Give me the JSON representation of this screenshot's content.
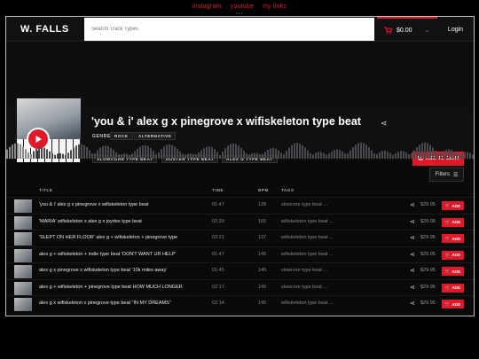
{
  "top_links": [
    "instagram",
    "youtube",
    "my links"
  ],
  "header": {
    "logo": "W. FALLS",
    "search_placeholder": "Search Track Types",
    "cart_total": "$0.00",
    "login_label": "Login"
  },
  "featured": {
    "title": "'you & i' alex g x pinegrove x wifiskeleton type beat",
    "genre_label": "GENRE",
    "genres": [
      "ROCK",
      "ALTERNATIVE"
    ],
    "tags": [
      "SLOWCORE TYPE BEAT",
      "DUSTER TYPE BEAT",
      "ALEX G TYPE BEAT"
    ],
    "buy_label": "ADD TO CART"
  },
  "filters_label": "Filters",
  "table": {
    "headers": {
      "title": "TITLE",
      "time": "TIME",
      "bpm": "BPM",
      "tags": "TAGS"
    },
    "add_label": "ADD",
    "rows": [
      {
        "title": "'you & i' alex g x pinegrove x wifiskeleton type beat",
        "time": "01:47",
        "bpm": "128",
        "tags": "slowcore type beat ...",
        "price": "$29.95"
      },
      {
        "title": "'MARIA' wifiskeleton x alex g x joydes type beat",
        "time": "02:29",
        "bpm": "165",
        "tags": "wifiskeleton type beat ...",
        "price": "$29.95"
      },
      {
        "title": "'SLEPT ON HER FLOOR' alex g + wifiskeleton + pinegrove type",
        "time": "03:21",
        "bpm": "137",
        "tags": "wifiskeleton type beat ...",
        "price": "$29.95"
      },
      {
        "title": "alex g + wifiskeleton + indie type beat 'DON'T WANT UR HELP'",
        "time": "01:47",
        "bpm": "145",
        "tags": "wifiskeleton type beat ...",
        "price": "$29.95"
      },
      {
        "title": "alex g x pinegrove x wifiskeleton type beat '10k miles away'",
        "time": "01:45",
        "bpm": "145",
        "tags": "slowcore type beat ...",
        "price": "$29.95"
      },
      {
        "title": "alex g + wifiskeleton + pinegrove type beat HOW MUCH LONGER",
        "time": "02:17",
        "bpm": "145",
        "tags": "slowcore type beat ...",
        "price": "$29.95"
      },
      {
        "title": "alex g x wifiskeleton x pinegrove type beat \"IN MY DREAMS\"",
        "time": "02:14",
        "bpm": "145",
        "tags": "wifiskeleton type beat ...",
        "price": "$29.95"
      }
    ]
  },
  "colors": {
    "accent": "#e0182a",
    "background": "#0a0a0b"
  }
}
